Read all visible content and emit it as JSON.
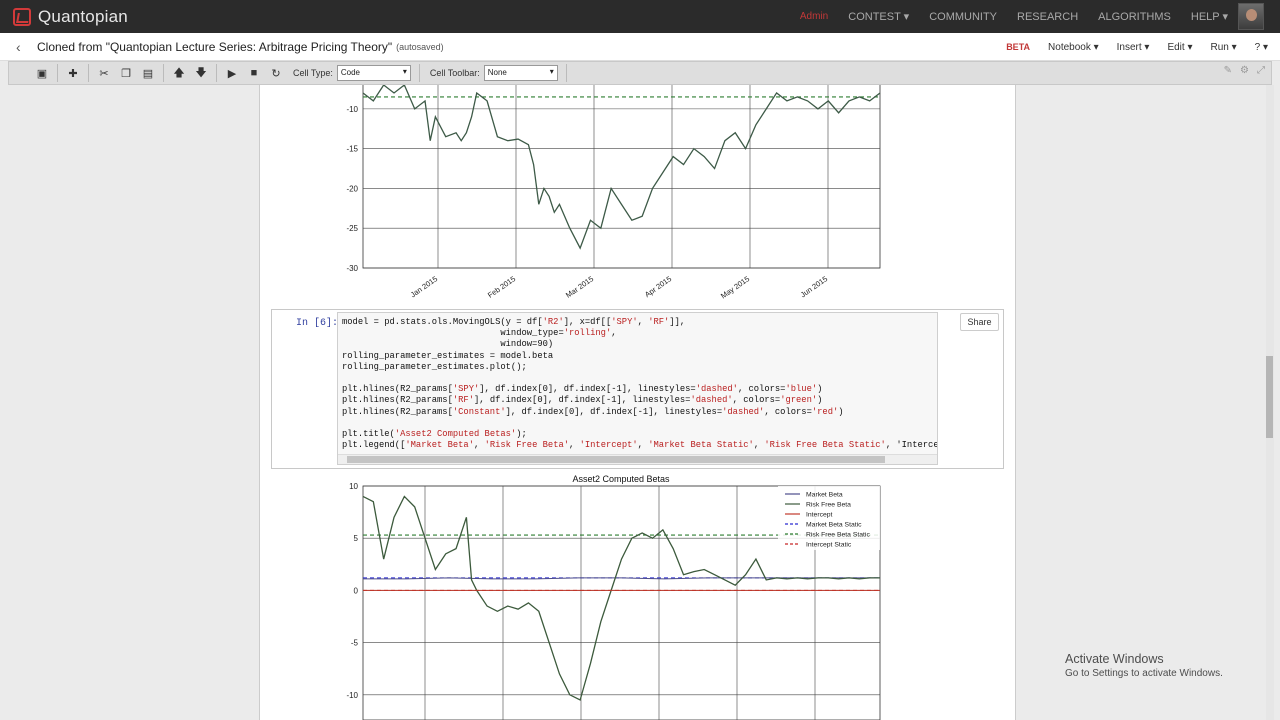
{
  "topnav": {
    "brand": "Quantopian",
    "admin": "Admin",
    "links": [
      "CONTEST ▾",
      "COMMUNITY",
      "RESEARCH",
      "ALGORITHMS",
      "HELP ▾"
    ]
  },
  "header": {
    "back": "‹",
    "title": "Cloned from \"Quantopian Lecture Series: Arbitrage Pricing Theory\"",
    "autosaved": "(autosaved)",
    "beta": "BETA",
    "menus": [
      "Notebook ▾",
      "Insert ▾",
      "Edit ▾",
      "Run ▾",
      "? ▾"
    ]
  },
  "toolbar": {
    "cell_type_label": "Cell Type:",
    "cell_type_value": "Code",
    "cell_toolbar_label": "Cell Toolbar:",
    "cell_toolbar_value": "None"
  },
  "cell": {
    "prompt": "In [6]:",
    "share": "Share",
    "code_lines": [
      "model = pd.stats.ols.MovingOLS(y = df['R2'], x=df[['SPY', 'RF']],",
      "                              window_type='rolling',",
      "                              window=90)",
      "rolling_parameter_estimates = model.beta",
      "rolling_parameter_estimates.plot();",
      "",
      "plt.hlines(R2_params['SPY'], df.index[0], df.index[-1], linestyles='dashed', colors='blue')",
      "plt.hlines(R2_params['RF'], df.index[0], df.index[-1], linestyles='dashed', colors='green')",
      "plt.hlines(R2_params['Constant'], df.index[0], df.index[-1], linestyles='dashed', colors='red')",
      "",
      "plt.title('Asset2 Computed Betas');",
      "plt.legend(['Market Beta', 'Risk Free Beta', 'Intercept', 'Market Beta Static', 'Risk Free Beta Static', 'Intercept S"
    ]
  },
  "chart_data": [
    {
      "type": "line",
      "title": "",
      "ylim": [
        -30,
        -7
      ],
      "yticks": [
        "-10",
        "-15",
        "-20",
        "-25",
        "-30"
      ],
      "xticks": [
        "Jan 2015",
        "Feb 2015",
        "Mar 2015",
        "Apr 2015",
        "May 2015",
        "Jun 2015"
      ],
      "reference_line": -8.5,
      "series": [
        {
          "x": [
            0,
            2,
            4,
            6,
            8,
            10,
            12,
            13,
            14,
            16,
            18,
            19,
            20,
            21,
            22,
            24,
            26,
            28,
            30,
            32,
            33,
            34,
            35,
            36,
            37,
            38,
            40,
            42,
            44,
            46,
            48,
            50,
            52,
            54,
            56,
            58,
            60,
            62,
            64,
            66,
            68,
            70,
            72,
            74,
            76,
            78,
            80,
            82,
            84,
            86,
            88,
            90,
            92,
            94,
            96,
            98,
            100
          ],
          "values": [
            -8,
            -9,
            -7,
            -8,
            -7,
            -10,
            -9,
            -14,
            -11,
            -13.5,
            -13,
            -14,
            -13,
            -11,
            -8,
            -9,
            -13.5,
            -14,
            -13.8,
            -14.5,
            -17,
            -22,
            -20,
            -21,
            -23,
            -22,
            -25,
            -27.5,
            -24,
            -25,
            -20,
            -22,
            -24,
            -23.5,
            -20,
            -18,
            -16,
            -17,
            -15,
            -16,
            -17.5,
            -14,
            -13,
            -15,
            -12,
            -10,
            -8,
            -9,
            -8.5,
            -9,
            -10,
            -9,
            -10.5,
            -9,
            -8.5,
            -9,
            -8
          ]
        }
      ]
    },
    {
      "type": "line",
      "title": "Asset2 Computed Betas",
      "ylim": [
        -10.5,
        10
      ],
      "yticks": [
        "10",
        "5",
        "0",
        "-5",
        "-10"
      ],
      "series": [
        {
          "name": "Market Beta",
          "color": "#4c4c8c",
          "values": [
            1.1,
            1.1,
            1.2,
            1.1,
            1.1,
            1.2,
            1.2,
            1.1,
            1.2,
            1.2,
            1.2,
            1.2,
            1.2
          ]
        },
        {
          "name": "Risk Free Beta",
          "color": "#3c5a3c",
          "x": [
            0,
            2,
            4,
            6,
            8,
            10,
            12,
            14,
            16,
            18,
            20,
            21,
            22,
            24,
            26,
            28,
            30,
            32,
            34,
            36,
            38,
            40,
            42,
            44,
            46,
            48,
            50,
            52,
            54,
            56,
            58,
            60,
            62,
            64,
            66,
            68,
            70,
            72,
            74,
            76,
            78,
            80,
            82,
            84,
            86,
            88,
            90,
            92,
            94,
            96,
            98,
            100
          ],
          "values": [
            9,
            8.5,
            3,
            7,
            9,
            8,
            5,
            2,
            3.5,
            4,
            7,
            1,
            0,
            -1.5,
            -2,
            -1.5,
            -1.8,
            -1.2,
            -2,
            -5,
            -8,
            -10,
            -10.5,
            -7,
            -3,
            0,
            3,
            5,
            5.5,
            5,
            5.8,
            4,
            1.5,
            1.8,
            2,
            1.5,
            1,
            0.5,
            1.5,
            3,
            1,
            1.2,
            1.1,
            1.2,
            1.1,
            1.2,
            1.2,
            1.1,
            1.2,
            1.1,
            1.2,
            1.2
          ]
        },
        {
          "name": "Intercept",
          "color": "#c0392b",
          "values": [
            0,
            0,
            0,
            0,
            0,
            0,
            0,
            0,
            0,
            0,
            0,
            0,
            0
          ]
        },
        {
          "name": "Market Beta Static",
          "color": "#2b2bd0",
          "style": "dashed",
          "constant": 1.2
        },
        {
          "name": "Risk Free Beta Static",
          "color": "#2e7d32",
          "style": "dashed",
          "constant": 5.3
        },
        {
          "name": "Intercept Static",
          "color": "#c62828",
          "style": "dashed",
          "constant": 0
        }
      ]
    }
  ],
  "watermark": {
    "line1": "Activate Windows",
    "line2": "Go to Settings to activate Windows."
  }
}
